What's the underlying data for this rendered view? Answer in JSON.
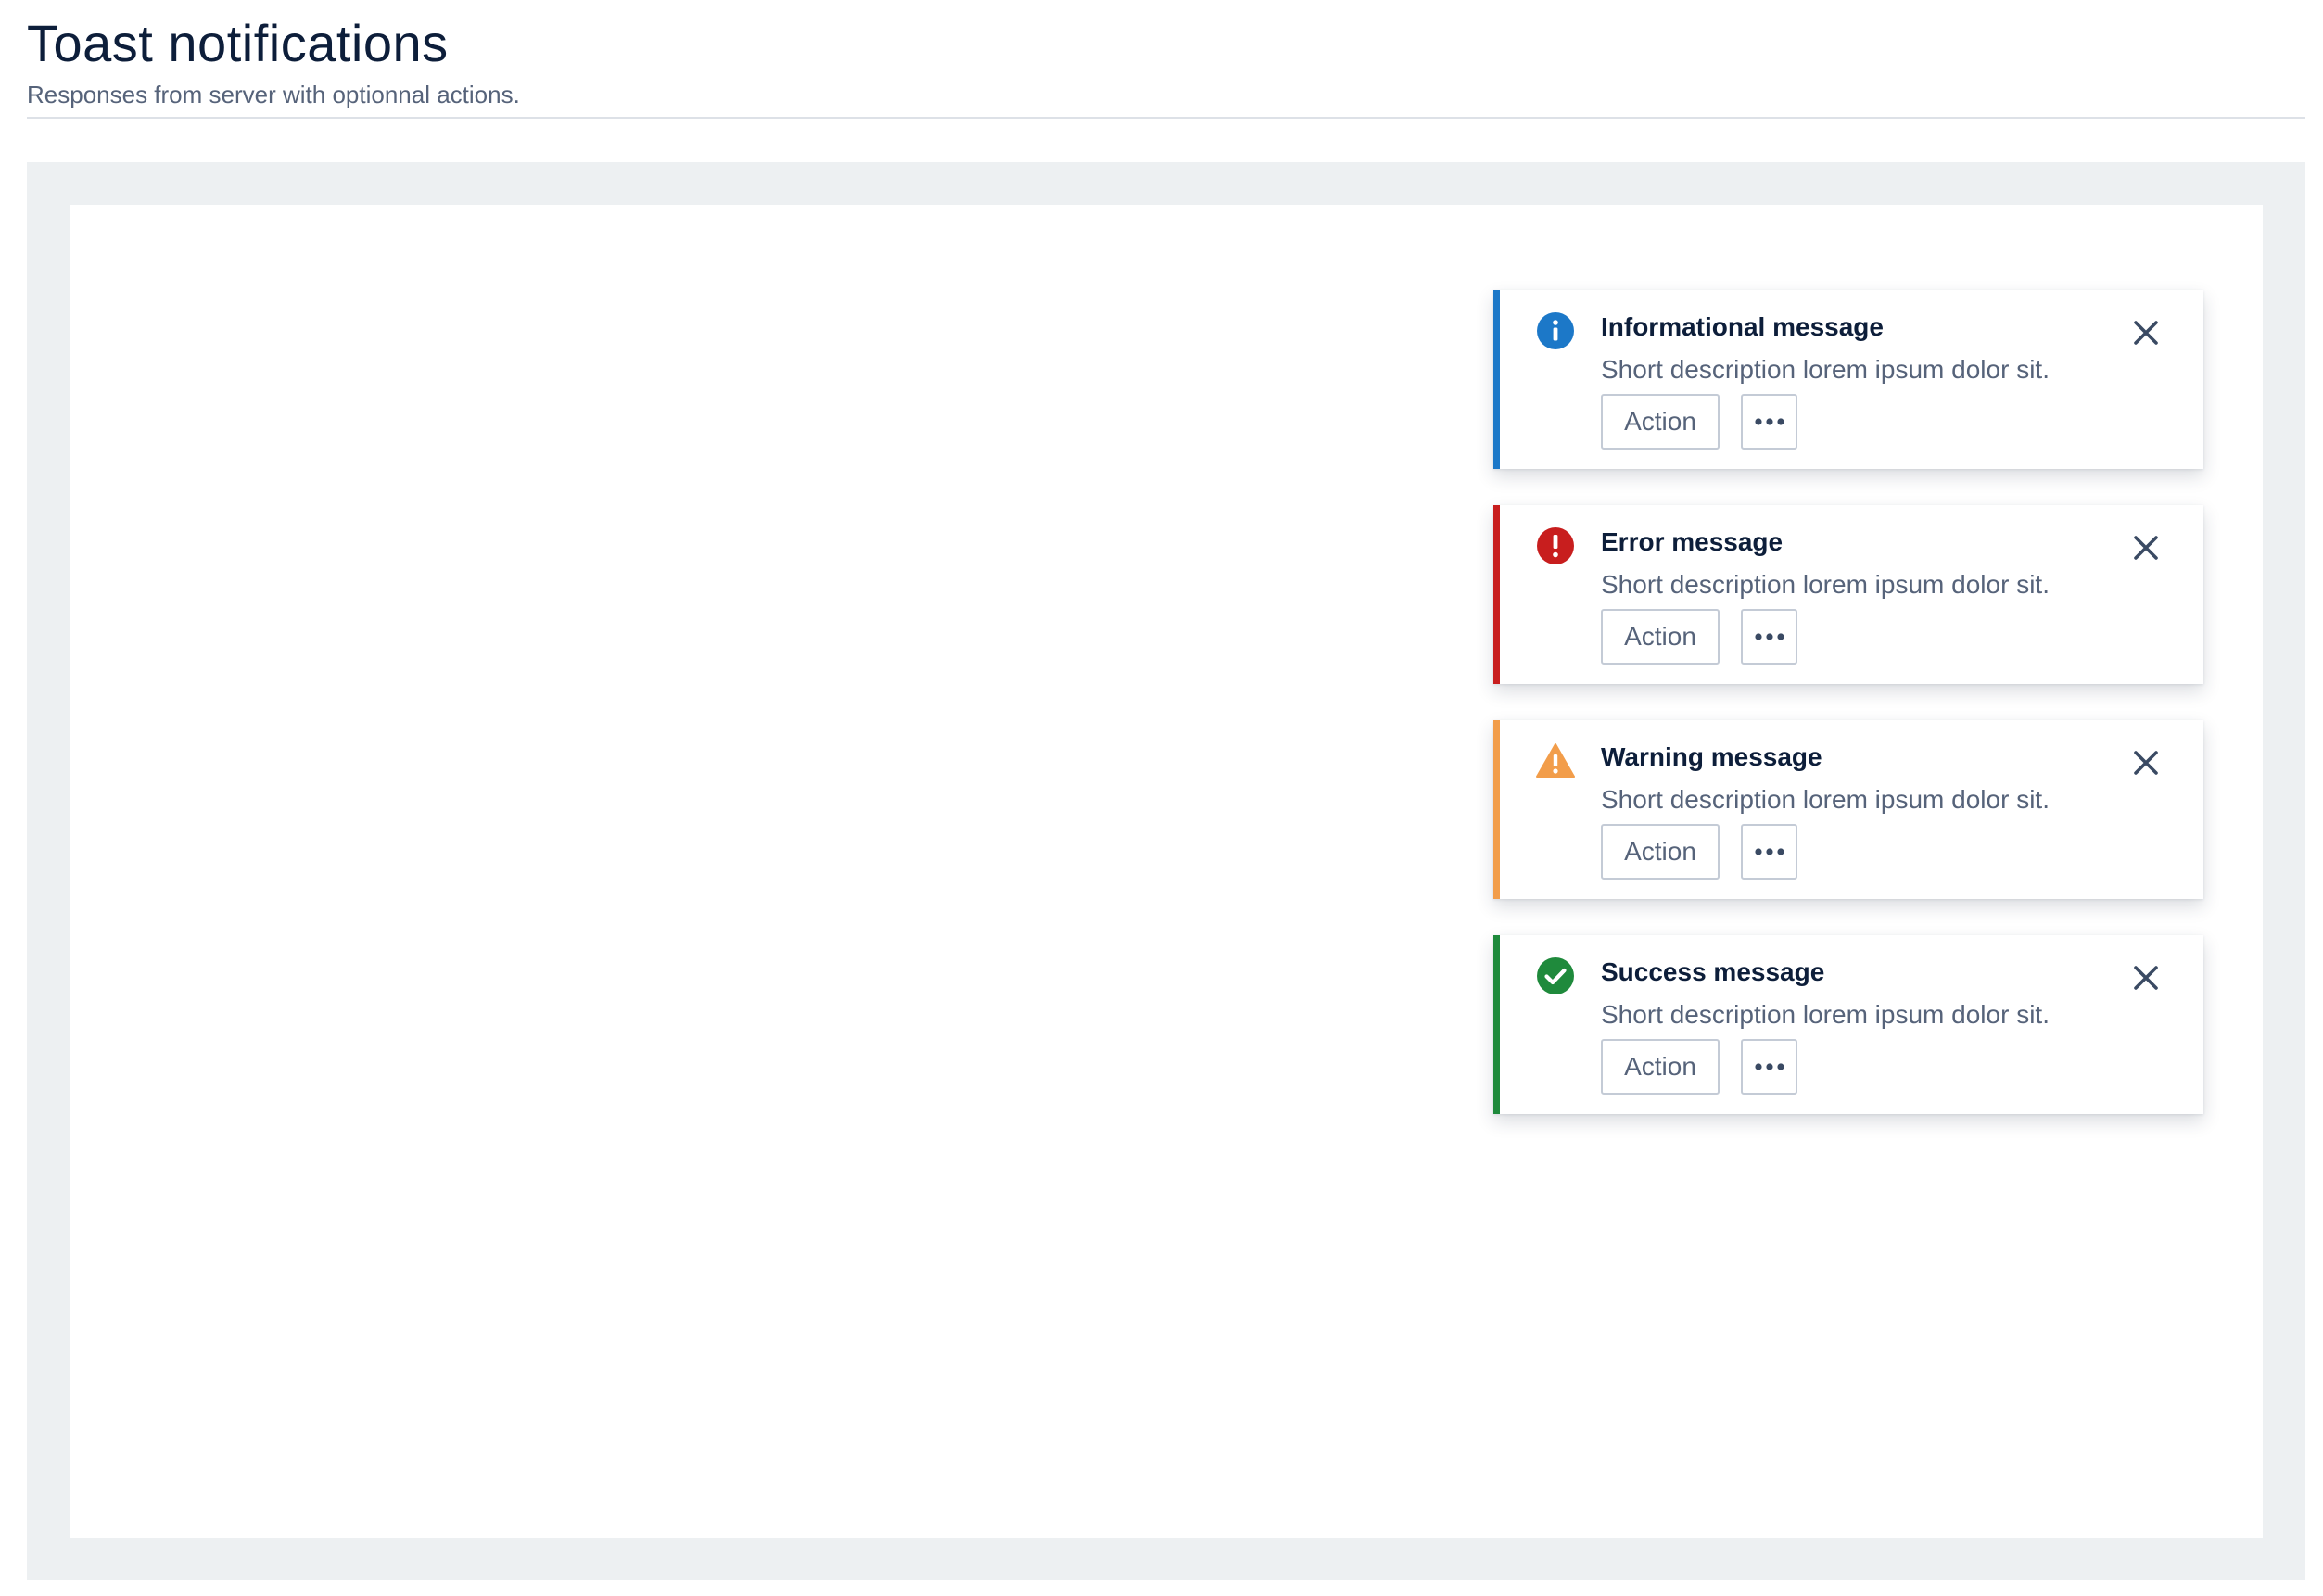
{
  "header": {
    "title": "Toast notifications",
    "subtitle": "Responses from server with optionnal actions."
  },
  "toasts": [
    {
      "type": "info",
      "icon": "info-icon",
      "color": "#1c78c8",
      "title": "Informational message",
      "description": "Short description lorem ipsum dolor sit.",
      "action_label": "Action",
      "more_icon": "ellipsis-icon",
      "close_icon": "close-icon"
    },
    {
      "type": "error",
      "icon": "error-icon",
      "color": "#c81e1e",
      "title": "Error message",
      "description": "Short description lorem ipsum dolor sit.",
      "action_label": "Action",
      "more_icon": "ellipsis-icon",
      "close_icon": "close-icon"
    },
    {
      "type": "warning",
      "icon": "warning-icon",
      "color": "#f29d4a",
      "title": "Warning message",
      "description": "Short description lorem ipsum dolor sit.",
      "action_label": "Action",
      "more_icon": "ellipsis-icon",
      "close_icon": "close-icon"
    },
    {
      "type": "success",
      "icon": "check-circle-icon",
      "color": "#1f8a3c",
      "title": "Success message",
      "description": "Short description lorem ipsum dolor sit.",
      "action_label": "Action",
      "more_icon": "ellipsis-icon",
      "close_icon": "close-icon"
    }
  ],
  "colors": {
    "stage_background": "#edf0f2",
    "text_primary": "#0d1e3a",
    "text_secondary": "#56637a",
    "border": "#c4cbd6"
  }
}
